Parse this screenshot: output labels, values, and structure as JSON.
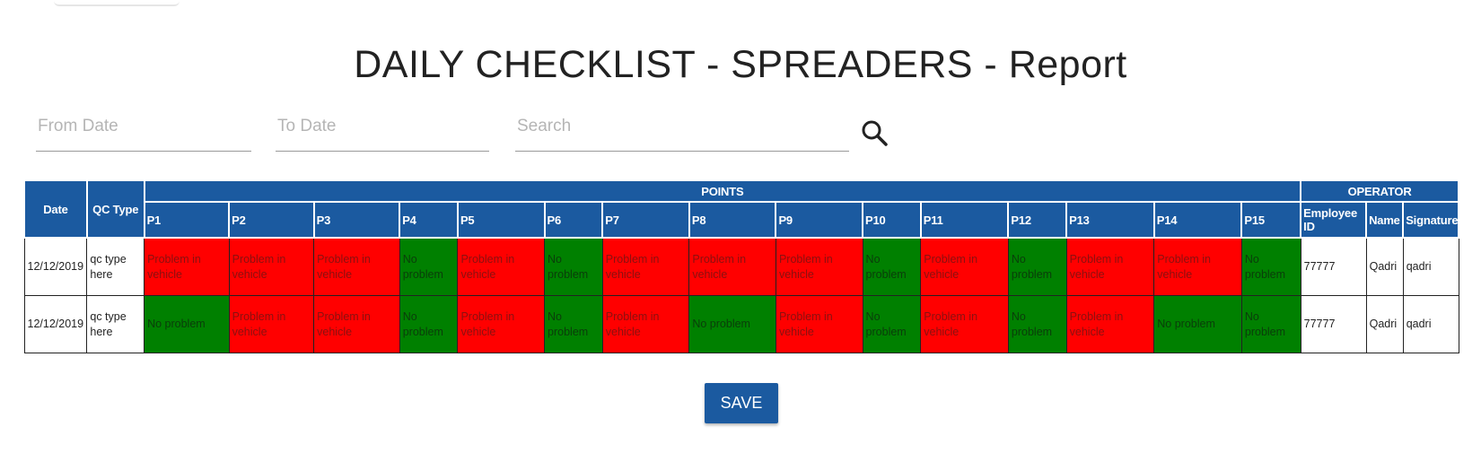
{
  "page": {
    "title": "DAILY CHECKLIST - SPREADERS - Report"
  },
  "filters": {
    "from_placeholder": "From Date",
    "to_placeholder": "To Date",
    "search_placeholder": "Search",
    "search_icon": "search-icon"
  },
  "table": {
    "group_headers": {
      "points": "POINTS",
      "operator": "OPERATOR"
    },
    "fixed_headers": {
      "date": "Date",
      "qc_type": "QC Type"
    },
    "point_headers": [
      "P1",
      "P2",
      "P3",
      "P4",
      "P5",
      "P6",
      "P7",
      "P8",
      "P9",
      "P10",
      "P11",
      "P12",
      "P13",
      "P14",
      "P15"
    ],
    "operator_headers": {
      "employee_id": "Employee ID",
      "name": "Name",
      "signature": "Signature"
    },
    "status_colors": {
      "problem": "#ff0000",
      "no_problem": "#008000"
    },
    "rows": [
      {
        "date": "12/12/2019",
        "qc_type": "qc type here",
        "points": [
          {
            "text": "Problem in vehicle",
            "status": "problem"
          },
          {
            "text": "Problem in vehicle",
            "status": "problem"
          },
          {
            "text": "Problem in vehicle",
            "status": "problem"
          },
          {
            "text": "No problem",
            "status": "no_problem"
          },
          {
            "text": "Problem in vehicle",
            "status": "problem"
          },
          {
            "text": "No problem",
            "status": "no_problem"
          },
          {
            "text": "Problem in vehicle",
            "status": "problem"
          },
          {
            "text": "Problem in vehicle",
            "status": "problem"
          },
          {
            "text": "Problem in vehicle",
            "status": "problem"
          },
          {
            "text": "No problem",
            "status": "no_problem"
          },
          {
            "text": "Problem in vehicle",
            "status": "problem"
          },
          {
            "text": "No problem",
            "status": "no_problem"
          },
          {
            "text": "Problem in vehicle",
            "status": "problem"
          },
          {
            "text": "Problem in vehicle",
            "status": "problem"
          },
          {
            "text": "No problem",
            "status": "no_problem"
          }
        ],
        "employee_id": "77777",
        "name": "Qadri",
        "signature": "qadri"
      },
      {
        "date": "12/12/2019",
        "qc_type": "qc type here",
        "points": [
          {
            "text": "No problem",
            "status": "no_problem"
          },
          {
            "text": "Problem in vehicle",
            "status": "problem"
          },
          {
            "text": "Problem in vehicle",
            "status": "problem"
          },
          {
            "text": "No problem",
            "status": "no_problem"
          },
          {
            "text": "Problem in vehicle",
            "status": "problem"
          },
          {
            "text": "No problem",
            "status": "no_problem"
          },
          {
            "text": "Problem in vehicle",
            "status": "problem"
          },
          {
            "text": "No problem",
            "status": "no_problem"
          },
          {
            "text": "Problem in vehicle",
            "status": "problem"
          },
          {
            "text": "No problem",
            "status": "no_problem"
          },
          {
            "text": "Problem in vehicle",
            "status": "problem"
          },
          {
            "text": "No problem",
            "status": "no_problem"
          },
          {
            "text": "Problem in vehicle",
            "status": "problem"
          },
          {
            "text": "No problem",
            "status": "no_problem"
          },
          {
            "text": "No problem",
            "status": "no_problem"
          }
        ],
        "employee_id": "77777",
        "name": "Qadri",
        "signature": "qadri"
      }
    ]
  },
  "actions": {
    "save_label": "SAVE"
  }
}
